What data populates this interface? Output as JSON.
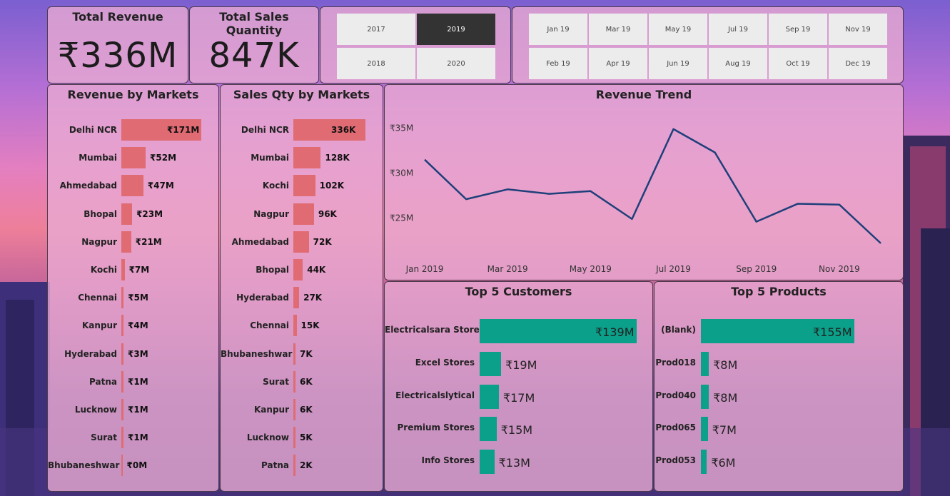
{
  "kpis": {
    "revenue": {
      "title": "Total Revenue",
      "value": "₹336M"
    },
    "quantity": {
      "title": "Total Sales Quantity",
      "value": "847K"
    }
  },
  "year_slicer": {
    "items": [
      "2017",
      "2019",
      "2018",
      "2020"
    ],
    "selected": "2019"
  },
  "month_slicer": {
    "items": [
      "Jan 19",
      "Mar 19",
      "May 19",
      "Jul 19",
      "Sep 19",
      "Nov 19",
      "Feb 19",
      "Apr 19",
      "Jun 19",
      "Aug 19",
      "Oct 19",
      "Dec 19"
    ]
  },
  "colors": {
    "market_bar": "#e06b72",
    "top5_bar": "#0aa08a",
    "trend_line": "#1f3f7a",
    "slicer_selected": "#333333"
  },
  "chart_data": [
    {
      "type": "bar",
      "title": "Revenue by Markets",
      "orientation": "horizontal",
      "categories": [
        "Delhi NCR",
        "Mumbai",
        "Ahmedabad",
        "Bhopal",
        "Nagpur",
        "Kochi",
        "Chennai",
        "Kanpur",
        "Hyderabad",
        "Patna",
        "Lucknow",
        "Surat",
        "Bhubaneshwar"
      ],
      "values": [
        171,
        52,
        47,
        23,
        21,
        7,
        5,
        4,
        3,
        1,
        1,
        1,
        0
      ],
      "labels": [
        "₹171M",
        "₹52M",
        "₹47M",
        "₹23M",
        "₹21M",
        "₹7M",
        "₹5M",
        "₹4M",
        "₹3M",
        "₹1M",
        "₹1M",
        "₹1M",
        "₹0M"
      ],
      "unit": "M"
    },
    {
      "type": "bar",
      "title": "Sales Qty by Markets",
      "orientation": "horizontal",
      "categories": [
        "Delhi NCR",
        "Mumbai",
        "Kochi",
        "Nagpur",
        "Ahmedabad",
        "Bhopal",
        "Hyderabad",
        "Chennai",
        "Bhubaneshwar",
        "Surat",
        "Kanpur",
        "Lucknow",
        "Patna"
      ],
      "values": [
        336,
        128,
        102,
        96,
        72,
        44,
        27,
        15,
        7,
        6,
        6,
        5,
        2
      ],
      "labels": [
        "336K",
        "128K",
        "102K",
        "96K",
        "72K",
        "44K",
        "27K",
        "15K",
        "7K",
        "6K",
        "6K",
        "5K",
        "2K"
      ],
      "unit": "K"
    },
    {
      "type": "line",
      "title": "Revenue Trend",
      "x": [
        "Jan 2019",
        "Feb 2019",
        "Mar 2019",
        "Apr 2019",
        "May 2019",
        "Jun 2019",
        "Jul 2019",
        "Aug 2019",
        "Sep 2019",
        "Oct 2019",
        "Nov 2019",
        "Dec 2019"
      ],
      "x_tick_labels": [
        "Jan 2019",
        "Mar 2019",
        "May 2019",
        "Jul 2019",
        "Sep 2019",
        "Nov 2019"
      ],
      "values": [
        31.5,
        27.1,
        28.2,
        27.7,
        28.0,
        24.9,
        34.9,
        32.3,
        24.6,
        26.6,
        26.5,
        22.2
      ],
      "y_ticks": [
        25,
        30,
        35
      ],
      "y_tick_labels": [
        "₹25M",
        "₹30M",
        "₹35M"
      ],
      "ylim": [
        21,
        36
      ]
    },
    {
      "type": "bar",
      "title": "Top 5 Customers",
      "orientation": "horizontal",
      "categories": [
        "Electricalsara Stores",
        "Excel Stores",
        "Electricalslytical",
        "Premium Stores",
        "Info Stores"
      ],
      "values": [
        139,
        19,
        17,
        15,
        13
      ],
      "labels": [
        "₹139M",
        "₹19M",
        "₹17M",
        "₹15M",
        "₹13M"
      ]
    },
    {
      "type": "bar",
      "title": "Top 5 Products",
      "orientation": "horizontal",
      "categories": [
        "(Blank)",
        "Prod018",
        "Prod040",
        "Prod065",
        "Prod053"
      ],
      "values": [
        155,
        8,
        8,
        7,
        6
      ],
      "labels": [
        "₹155M",
        "₹8M",
        "₹8M",
        "₹7M",
        "₹6M"
      ]
    }
  ]
}
